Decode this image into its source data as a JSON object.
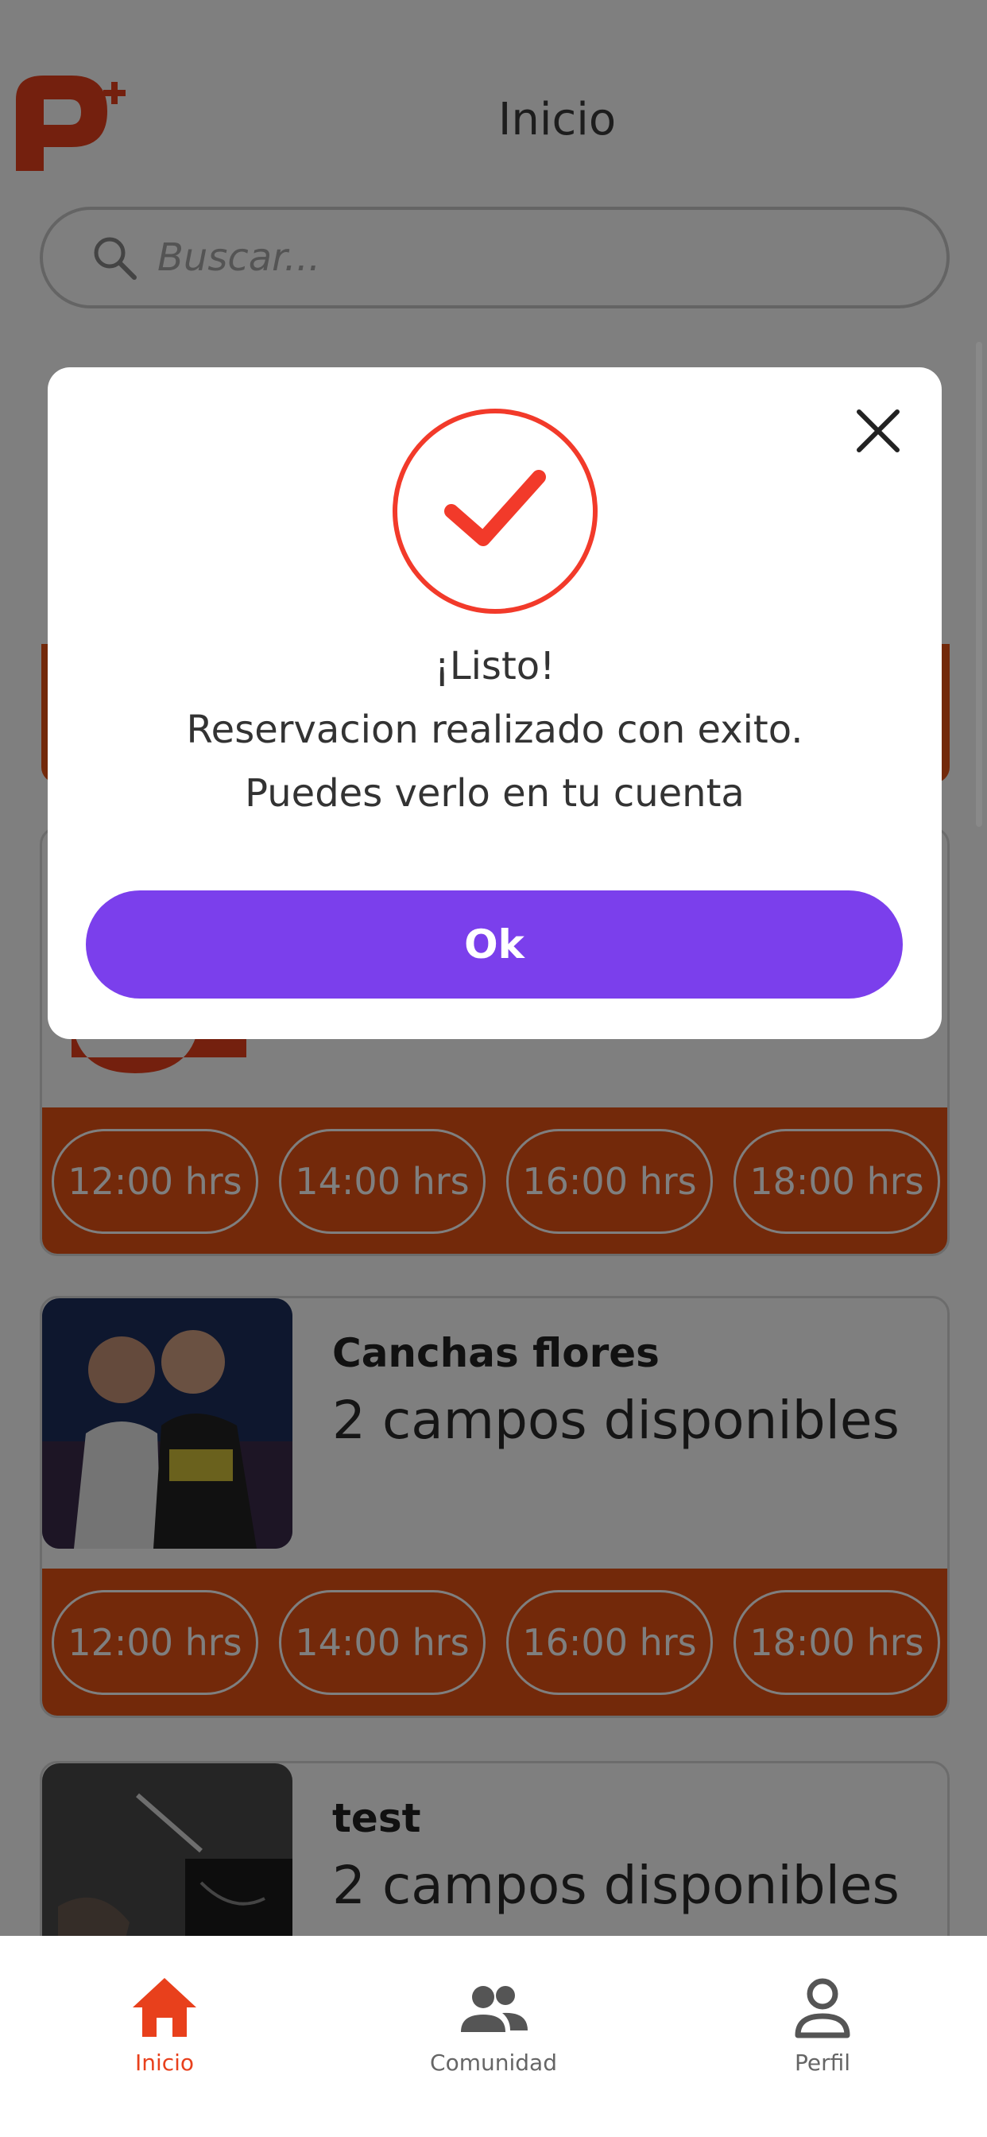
{
  "header": {
    "title": "Inicio"
  },
  "search": {
    "placeholder": "Buscar..."
  },
  "cards": [
    {
      "name": "",
      "subtitle": "",
      "slots": [
        "12:00 hrs",
        "14:00 hrs",
        "16:00 hrs",
        "18:00 hrs"
      ]
    },
    {
      "name": "Canchas flores",
      "subtitle": "2 campos disponibles",
      "slots": [
        "12:00 hrs",
        "14:00 hrs",
        "16:00 hrs",
        "18:00 hrs"
      ]
    },
    {
      "name": "test",
      "subtitle": "2 campos disponibles"
    }
  ],
  "modal": {
    "line1": "¡Listo!",
    "line2": "Reservacion realizado con exito.",
    "line3": "Puedes verlo en tu cuenta",
    "ok_label": "Ok"
  },
  "nav": [
    {
      "label": "Inicio",
      "icon": "home-icon",
      "active": true
    },
    {
      "label": "Comunidad",
      "icon": "people-icon",
      "active": false
    },
    {
      "label": "Perfil",
      "icon": "person-icon",
      "active": false
    }
  ],
  "colors": {
    "accent": "#e65214",
    "primary_button": "#7b3fec",
    "check": "#f23a2a",
    "nav_active": "#e8401c"
  }
}
